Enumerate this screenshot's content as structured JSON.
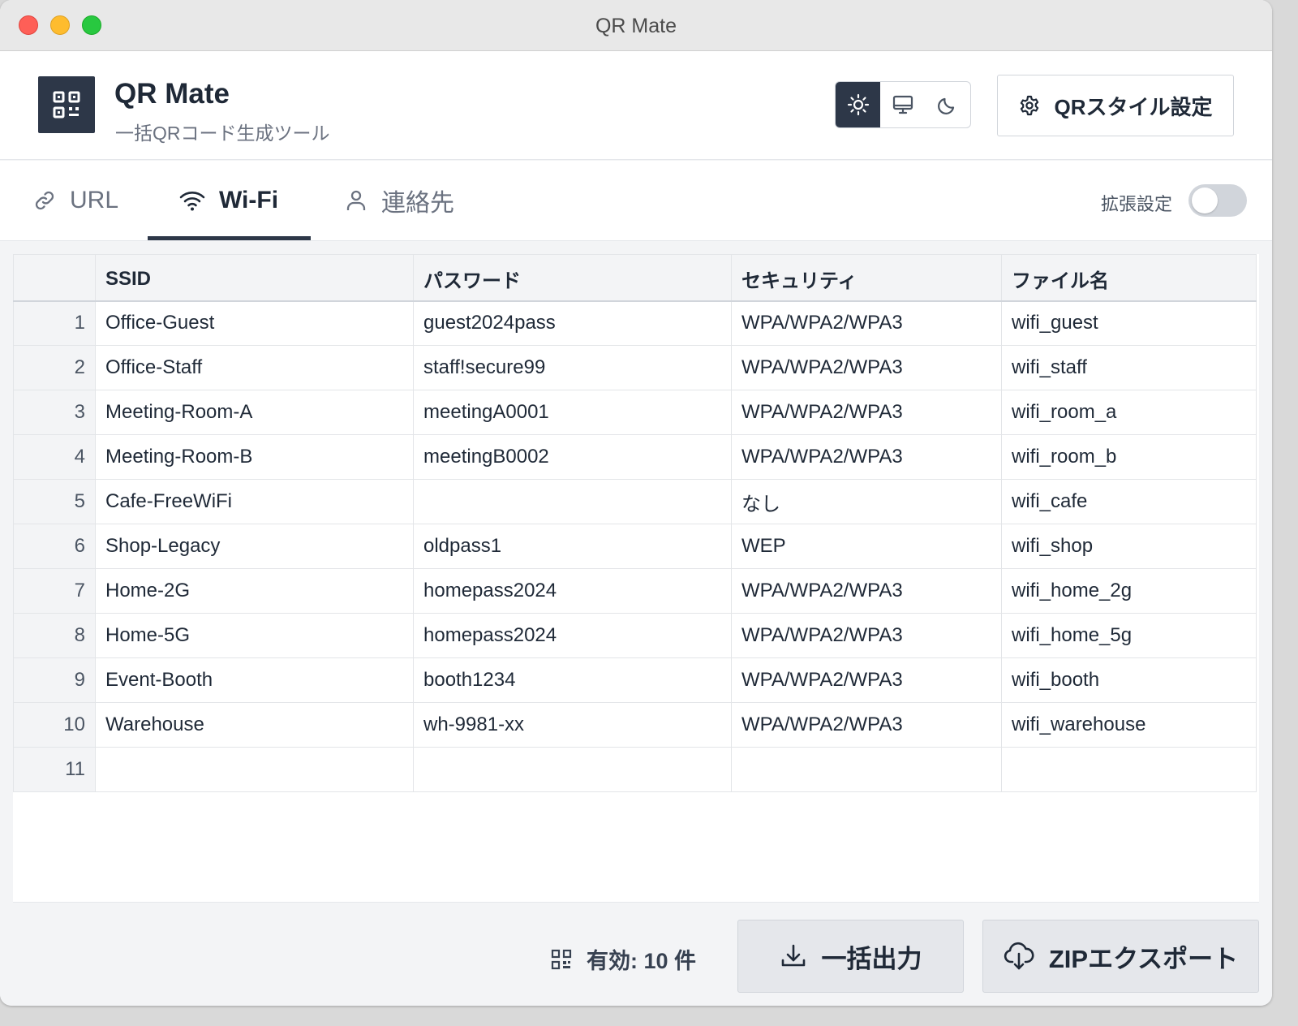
{
  "window": {
    "title": "QR Mate"
  },
  "header": {
    "app_name": "QR Mate",
    "app_subtitle": "一括QRコード生成ツール",
    "theme_options": [
      "sun-icon",
      "monitor-icon",
      "moon-icon"
    ],
    "theme_selected": "light",
    "style_button_label": "QRスタイル設定"
  },
  "tabs": {
    "items": [
      {
        "label": "URL",
        "icon": "link-icon"
      },
      {
        "label": "Wi-Fi",
        "icon": "wifi-icon"
      },
      {
        "label": "連絡先",
        "icon": "user-icon"
      }
    ],
    "active": "Wi-Fi",
    "extended_settings_label": "拡張設定",
    "extended_settings_on": false
  },
  "grid": {
    "columns": [
      "SSID",
      "パスワード",
      "セキュリティ",
      "ファイル名"
    ],
    "rows": [
      [
        "1",
        "Office-Guest",
        "guest2024pass",
        "WPA/WPA2/WPA3",
        "wifi_guest"
      ],
      [
        "2",
        "Office-Staff",
        "staff!secure99",
        "WPA/WPA2/WPA3",
        "wifi_staff"
      ],
      [
        "3",
        "Meeting-Room-A",
        "meetingA0001",
        "WPA/WPA2/WPA3",
        "wifi_room_a"
      ],
      [
        "4",
        "Meeting-Room-B",
        "meetingB0002",
        "WPA/WPA2/WPA3",
        "wifi_room_b"
      ],
      [
        "5",
        "Cafe-FreeWiFi",
        "",
        "なし",
        "wifi_cafe"
      ],
      [
        "6",
        "Shop-Legacy",
        "oldpass1",
        "WEP",
        "wifi_shop"
      ],
      [
        "7",
        "Home-2G",
        "homepass2024",
        "WPA/WPA2/WPA3",
        "wifi_home_2g"
      ],
      [
        "8",
        "Home-5G",
        "homepass2024",
        "WPA/WPA2/WPA3",
        "wifi_home_5g"
      ],
      [
        "9",
        "Event-Booth",
        "booth1234",
        "WPA/WPA2/WPA3",
        "wifi_booth"
      ],
      [
        "10",
        "Warehouse",
        "wh-9981-xx",
        "WPA/WPA2/WPA3",
        "wifi_warehouse"
      ],
      [
        "11",
        "",
        "",
        "",
        ""
      ]
    ]
  },
  "footer": {
    "valid_count_label": "有効: 10 件",
    "export_button_label": "一括出力",
    "zip_button_label": "ZIPエクスポート"
  },
  "colors": {
    "accent": "#2d3748",
    "background": "#f3f4f6"
  }
}
